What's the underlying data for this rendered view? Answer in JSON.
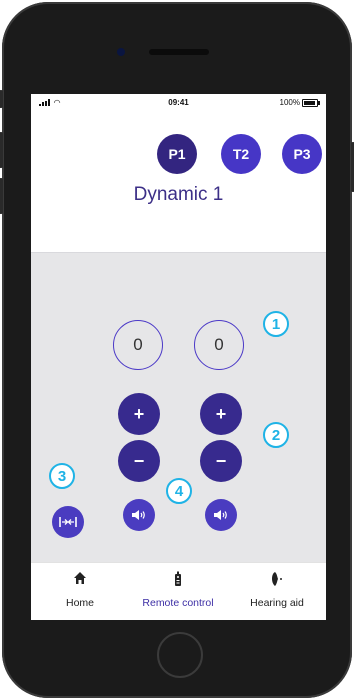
{
  "status": {
    "time": "09:41",
    "battery": "100%"
  },
  "programs": [
    {
      "label": "P1",
      "color": "#332580"
    },
    {
      "label": "T2",
      "color": "#4636c6"
    },
    {
      "label": "P3",
      "color": "#4636c6"
    }
  ],
  "program_title": "Dynamic 1",
  "volume": {
    "left_value": "0",
    "right_value": "0"
  },
  "buttons": {
    "plus": "+",
    "minus": "−"
  },
  "callouts": [
    "1",
    "2",
    "3",
    "4"
  ],
  "tabs": [
    {
      "label": "Home",
      "icon": "home-icon"
    },
    {
      "label": "Remote control",
      "icon": "remote-icon",
      "active": true
    },
    {
      "label": "Hearing aid",
      "icon": "hearing-aid-icon"
    }
  ],
  "colors": {
    "primary": "#372a8e",
    "accent": "#4a3cc0",
    "callout": "#1fb3e6"
  }
}
